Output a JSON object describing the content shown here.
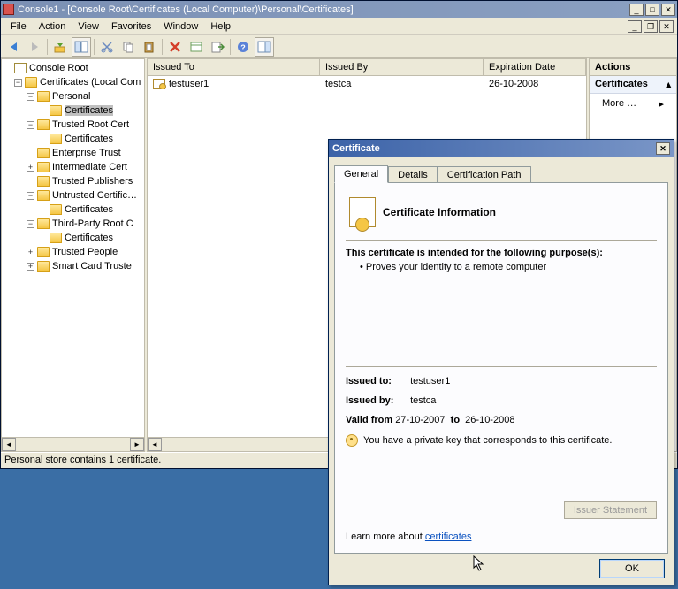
{
  "window": {
    "title": "Console1 - [Console Root\\Certificates (Local Computer)\\Personal\\Certificates]"
  },
  "menu": {
    "file": "File",
    "action": "Action",
    "view": "View",
    "favorites": "Favorites",
    "window": "Window",
    "help": "Help"
  },
  "tree": {
    "root": "Console Root",
    "certs_root": "Certificates (Local Com",
    "personal": "Personal",
    "certificates": "Certificates",
    "trusted_root": "Trusted Root Cert",
    "tr_certs": "Certificates",
    "enterprise": "Enterprise Trust",
    "intermediate": "Intermediate Cert",
    "trusted_pub": "Trusted Publishers",
    "untrusted": "Untrusted Certific…",
    "un_certs": "Certificates",
    "thirdparty": "Third-Party Root C",
    "tp_certs": "Certificates",
    "trusted_people": "Trusted People",
    "smartcard": "Smart Card Truste"
  },
  "list": {
    "col_issued_to": "Issued To",
    "col_issued_by": "Issued By",
    "col_exp": "Expiration Date",
    "rows": [
      {
        "issued_to": "testuser1",
        "issued_by": "testca",
        "exp": "26-10-2008"
      }
    ]
  },
  "actions": {
    "title": "Actions",
    "section": "Certificates",
    "more": "More …"
  },
  "status": "Personal store contains 1 certificate.",
  "cert": {
    "title": "Certificate",
    "tab_general": "General",
    "tab_details": "Details",
    "tab_path": "Certification Path",
    "header": "Certificate Information",
    "purpose_intro": "This certificate is intended for the following purpose(s):",
    "purpose_item": "Proves your identity to a remote computer",
    "issued_to_label": "Issued to:",
    "issued_to": "testuser1",
    "issued_by_label": "Issued by:",
    "issued_by": "testca",
    "valid_from_label": "Valid from",
    "valid_from": "27-10-2007",
    "valid_to_label": "to",
    "valid_to": "26-10-2008",
    "private_key": "You have a private key that corresponds to this certificate.",
    "issuer_statement": "Issuer Statement",
    "learn_prefix": "Learn more about ",
    "learn_link": "certificates",
    "ok": "OK"
  }
}
